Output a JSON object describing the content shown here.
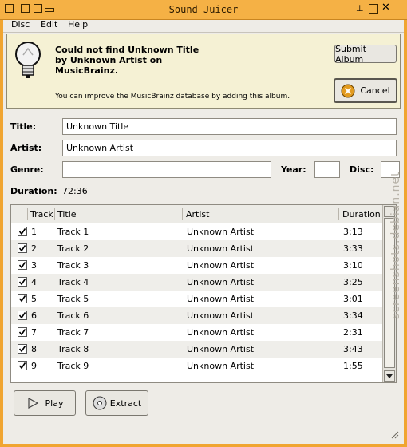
{
  "window": {
    "title": "Sound Juicer"
  },
  "menubar": {
    "items": [
      "Disc",
      "Edit",
      "Help"
    ]
  },
  "infobar": {
    "heading_line1": "Could not find Unknown Title",
    "heading_line2": "by Unknown Artist on",
    "heading_line3": "MusicBrainz.",
    "subtext": "You can improve the MusicBrainz database by adding this album.",
    "submit_label": "Submit Album",
    "cancel_label": "Cancel"
  },
  "form": {
    "title_label": "Title:",
    "title_value": "Unknown Title",
    "artist_label": "Artist:",
    "artist_value": "Unknown Artist",
    "genre_label": "Genre:",
    "genre_value": "",
    "year_label": "Year:",
    "year_value": "",
    "disc_label": "Disc:",
    "disc_value": "",
    "duration_label": "Duration:",
    "duration_value": "72:36"
  },
  "tracklist": {
    "columns": [
      "Track",
      "Title",
      "Artist",
      "Duration"
    ],
    "rows": [
      {
        "track": "1",
        "title": "Track 1",
        "artist": "Unknown Artist",
        "duration": "3:13",
        "checked": true
      },
      {
        "track": "2",
        "title": "Track 2",
        "artist": "Unknown Artist",
        "duration": "3:33",
        "checked": true
      },
      {
        "track": "3",
        "title": "Track 3",
        "artist": "Unknown Artist",
        "duration": "3:10",
        "checked": true
      },
      {
        "track": "4",
        "title": "Track 4",
        "artist": "Unknown Artist",
        "duration": "3:25",
        "checked": true
      },
      {
        "track": "5",
        "title": "Track 5",
        "artist": "Unknown Artist",
        "duration": "3:01",
        "checked": true
      },
      {
        "track": "6",
        "title": "Track 6",
        "artist": "Unknown Artist",
        "duration": "3:34",
        "checked": true
      },
      {
        "track": "7",
        "title": "Track 7",
        "artist": "Unknown Artist",
        "duration": "2:31",
        "checked": true
      },
      {
        "track": "8",
        "title": "Track 8",
        "artist": "Unknown Artist",
        "duration": "3:43",
        "checked": true
      },
      {
        "track": "9",
        "title": "Track 9",
        "artist": "Unknown Artist",
        "duration": "1:55",
        "checked": true
      }
    ]
  },
  "footer": {
    "play_label": "Play",
    "extract_label": "Extract"
  },
  "watermark": "screenshots.debian.net"
}
